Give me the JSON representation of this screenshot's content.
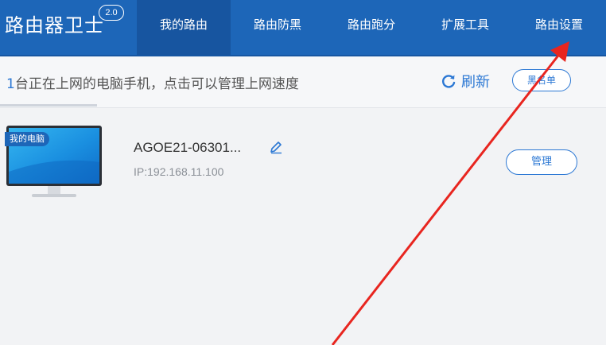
{
  "header": {
    "app_name": "路由器卫士",
    "version": "2.0",
    "tabs": [
      {
        "label": "我的路由",
        "active": true
      },
      {
        "label": "路由防黑",
        "active": false
      },
      {
        "label": "路由跑分",
        "active": false
      },
      {
        "label": "扩展工具",
        "active": false
      },
      {
        "label": "路由设置",
        "active": false
      }
    ]
  },
  "status_bar": {
    "count": "1",
    "text": "台正在上网的电脑手机，点击可以管理上网速度",
    "refresh_label": "刷新",
    "blacklist_label": "黑名单"
  },
  "devices": [
    {
      "badge": "我的电脑",
      "name": "AGOE21-06301...",
      "ip": "IP:192.168.11.100",
      "manage_label": "管理"
    }
  ],
  "colors": {
    "header_bg": "#1d66b8",
    "active_tab_bg": "#1755a0",
    "accent": "#2c78d4",
    "annotation_arrow": "#e8251f"
  },
  "icons": [
    "refresh-icon",
    "edit-pencil-icon",
    "monitor-icon"
  ]
}
